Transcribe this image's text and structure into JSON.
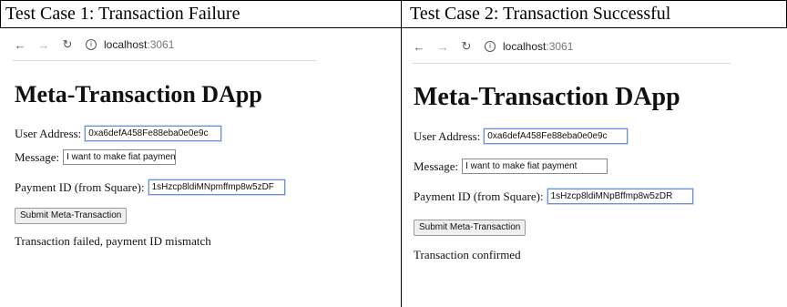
{
  "headers": {
    "case1": "Test Case 1: Transaction Failure",
    "case2": "Test Case 2: Transaction Successful"
  },
  "case1": {
    "browser": {
      "host": "localhost",
      "port": ":3061",
      "icons": [
        "back-arrow-icon",
        "forward-arrow-icon",
        "reload-icon",
        "info-icon"
      ]
    },
    "app_title": "Meta-Transaction DApp",
    "user_address": {
      "label": "User Address:",
      "value": "0xa6defA458Fe88eba0e0e9c"
    },
    "message": {
      "label": "Message:",
      "value": "I want to make fiat payment"
    },
    "payment_id": {
      "label": "Payment ID (from Square):",
      "value": "1sHzcp8ldiMNpmffmp8w5zDF"
    },
    "submit_label": "Submit Meta-Transaction",
    "status": "Transaction failed, payment ID mismatch"
  },
  "case2": {
    "browser": {
      "host": "localhost",
      "port": ":3061",
      "icons": [
        "back-arrow-icon",
        "forward-arrow-icon",
        "reload-icon",
        "info-icon"
      ]
    },
    "app_title": "Meta-Transaction DApp",
    "user_address": {
      "label": "User Address:",
      "value": "0xa6defA458Fe88eba0e0e9c"
    },
    "message": {
      "label": "Message:",
      "value": "I want to make fiat payment"
    },
    "payment_id": {
      "label": "Payment ID (from Square):",
      "value": "1sHzcp8ldiMNpBffmp8w5zDR"
    },
    "submit_label": "Submit Meta-Transaction",
    "status": "Transaction confirmed"
  }
}
